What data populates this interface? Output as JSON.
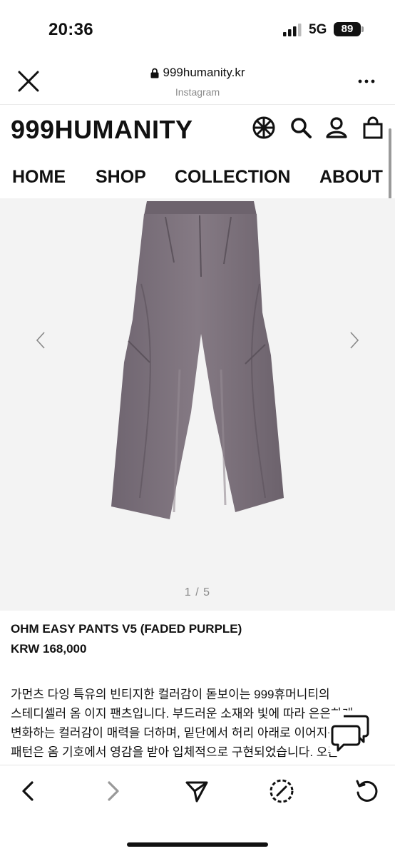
{
  "status_bar": {
    "time": "20:36",
    "network": "5G",
    "battery": "89"
  },
  "browser": {
    "url": "999humanity.kr",
    "source": "Instagram",
    "icons": [
      "close-icon",
      "lock-icon",
      "more-icon"
    ]
  },
  "site": {
    "logo": "999HUMANITY",
    "header_icons": [
      "globe-icon",
      "search-icon",
      "user-icon",
      "bag-icon"
    ],
    "nav": [
      {
        "label": "HOME"
      },
      {
        "label": "SHOP"
      },
      {
        "label": "COLLECTION"
      },
      {
        "label": "ABOUT"
      }
    ]
  },
  "gallery": {
    "counter": "1 / 5",
    "image_color": "#7a7079"
  },
  "product": {
    "title": "OHM EASY PANTS V5 (FADED PURPLE)",
    "price": "KRW 168,000",
    "description": [
      "가먼츠 다잉 특유의 빈티지한 컬러감이 돋보이는 999휴머니티의",
      "스테디셀러 옴 이지 팬츠입니다. 부드러운 소재와 빛에 따라 은은하게",
      "변화하는 컬러감이 매력을 더하며, 밑단에서 허리 아래로 이어지는",
      "패턴은 옴 기호에서 영감을 받아 입체적으로 구현되었습니다. 오픈"
    ]
  },
  "toolbar": {
    "icons": [
      "back-arrow-icon",
      "forward-arrow-icon",
      "share-icon",
      "compass-icon",
      "reload-icon"
    ]
  }
}
